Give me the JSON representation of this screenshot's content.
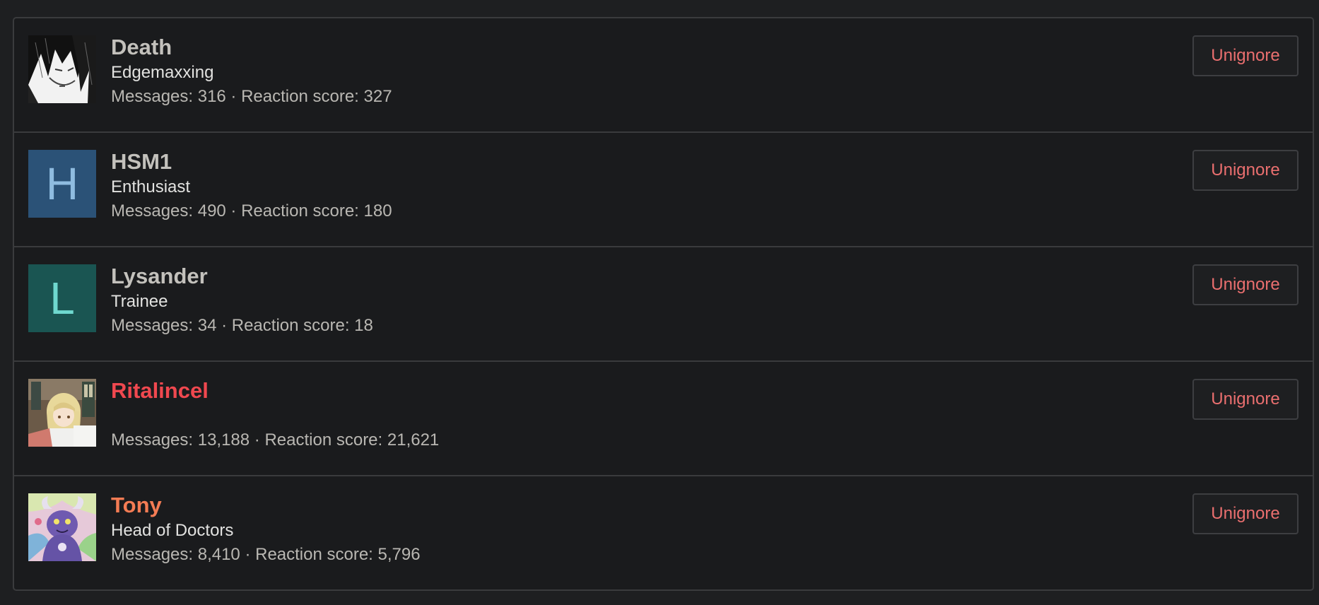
{
  "members": [
    {
      "username": "Death",
      "title": "Edgemaxxing",
      "stats": "Messages: 316 · Reaction score: 327",
      "username_color": "#c3c1bc",
      "avatar": {
        "kind": "image",
        "icon": "manga-portrait-avatar"
      },
      "button_label": "Unignore"
    },
    {
      "username": "HSM1",
      "title": "Enthusiast",
      "stats": "Messages: 490 · Reaction score: 180",
      "username_color": "#c3c1bc",
      "avatar": {
        "kind": "letter",
        "letter": "H",
        "bg": "#2b5277",
        "fg": "#8fbce0"
      },
      "button_label": "Unignore"
    },
    {
      "username": "Lysander",
      "title": "Trainee",
      "stats": "Messages: 34 · Reaction score: 18",
      "username_color": "#c3c1bc",
      "avatar": {
        "kind": "letter",
        "letter": "L",
        "bg": "#1a5552",
        "fg": "#6fd8cf"
      },
      "button_label": "Unignore"
    },
    {
      "username": "Ritalincel",
      "title": "",
      "stats": "Messages: 13,188 · Reaction score: 21,621",
      "username_color": "#f0484f",
      "avatar": {
        "kind": "image",
        "icon": "anime-girl-avatar"
      },
      "button_label": "Unignore"
    },
    {
      "username": "Tony",
      "title": "Head of Doctors",
      "stats": "Messages: 8,410 · Reaction score: 5,796",
      "username_color": "#f47c54",
      "avatar": {
        "kind": "image",
        "icon": "purple-demon-avatar"
      },
      "button_label": "Unignore"
    }
  ],
  "colors": {
    "page_bg": "#1e1f21",
    "panel_bg": "#1a1b1d",
    "border": "#3a3b3d",
    "button_text": "#ea6f6f"
  }
}
